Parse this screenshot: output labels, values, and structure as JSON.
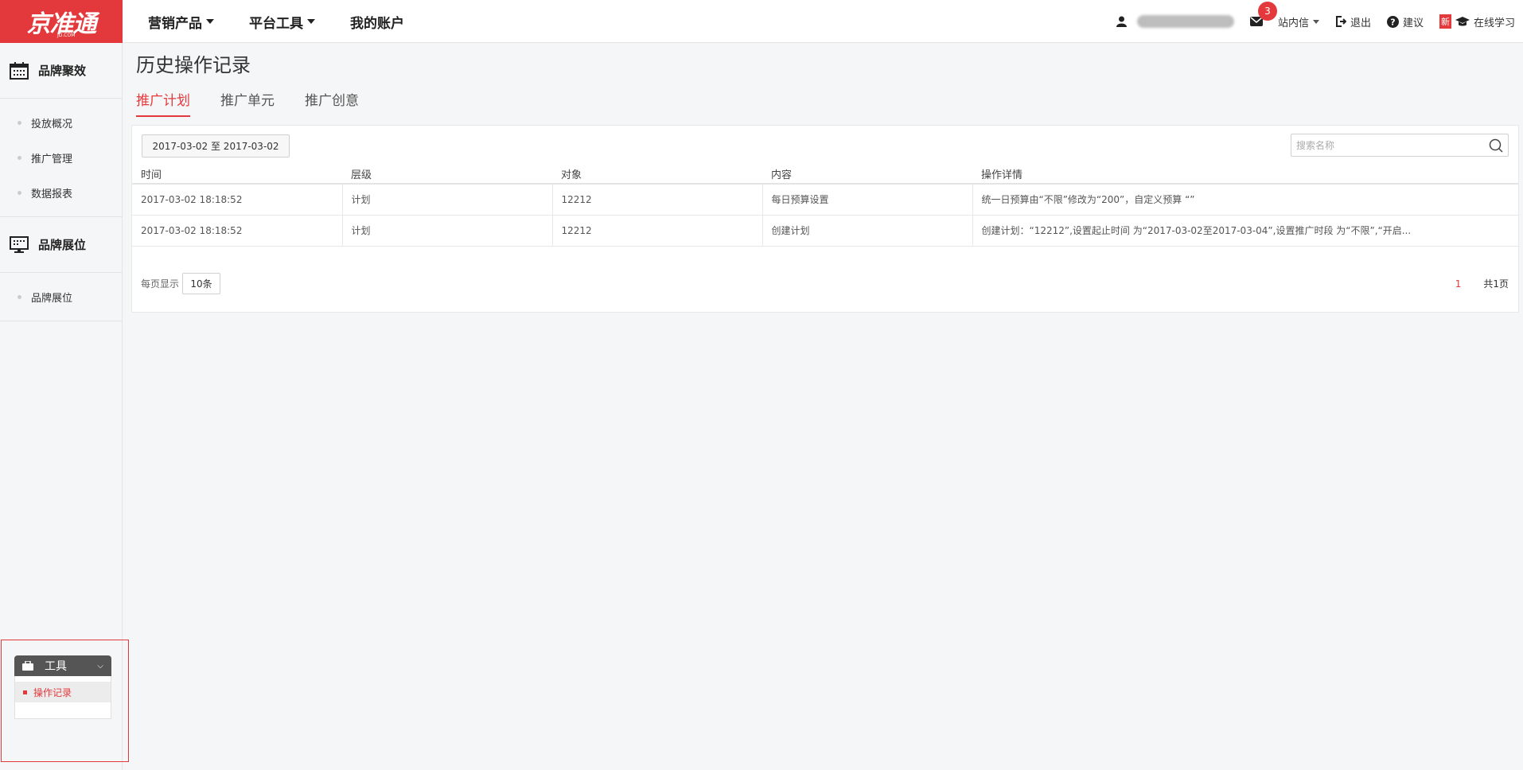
{
  "logo": {
    "text": "京准通",
    "sub": "JD.COM"
  },
  "topnav": [
    {
      "label": "营销产品",
      "has_caret": true
    },
    {
      "label": "平台工具",
      "has_caret": true
    },
    {
      "label": "我的账户",
      "has_caret": false
    }
  ],
  "topright": {
    "messages_count": "3",
    "messages_label": "站内信",
    "logout_label": "退出",
    "feedback_label": "建议",
    "new_tag": "新",
    "learning_label": "在线学习"
  },
  "sidebar": {
    "groups": [
      {
        "title": "品牌聚效",
        "icon": "calendar-icon",
        "items": [
          "投放概况",
          "推广管理",
          "数据报表"
        ]
      },
      {
        "title": "品牌展位",
        "icon": "monitor-icon",
        "items": [
          "品牌展位"
        ]
      }
    ],
    "tools": {
      "title": "工具",
      "item": "操作记录"
    }
  },
  "main": {
    "title": "历史操作记录",
    "tabs": [
      "推广计划",
      "推广单元",
      "推广创意"
    ],
    "active_tab": 0,
    "date_range": "2017-03-02 至 2017-03-02",
    "search_placeholder": "搜索名称",
    "table": {
      "columns": [
        "时间",
        "层级",
        "对象",
        "内容",
        "操作详情"
      ],
      "rows": [
        [
          "2017-03-02 18:18:52",
          "计划",
          "12212",
          "每日预算设置",
          "统一日预算由“不限”修改为“200”，自定义预算 “”"
        ],
        [
          "2017-03-02 18:18:52",
          "计划",
          "12212",
          "创建计划",
          "创建计划：“12212”,设置起止时间 为“2017-03-02至2017-03-04”,设置推广时段 为“不限”,“开启..."
        ]
      ]
    },
    "pager": {
      "per_page_label": "每页显示",
      "per_page_value": "10条",
      "current_page": "1",
      "total_label": "共1页"
    }
  },
  "colors": {
    "brand_red": "#e4393c",
    "tools_header": "#555555"
  }
}
